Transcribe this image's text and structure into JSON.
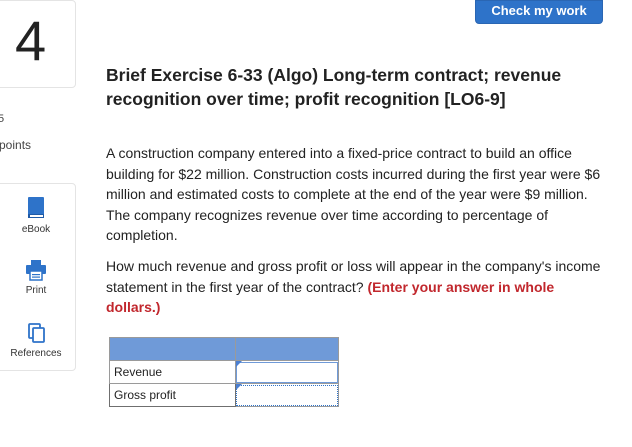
{
  "question": {
    "number": "4",
    "points_value": "5",
    "points_label": "points"
  },
  "tools": [
    {
      "label": "eBook",
      "icon": "book-icon"
    },
    {
      "label": "Print",
      "icon": "printer-icon"
    },
    {
      "label": "References",
      "icon": "references-icon"
    }
  ],
  "header": {
    "check_button": "Check my work"
  },
  "exercise": {
    "title": "Brief Exercise 6-33 (Algo) Long-term contract; revenue recognition over time; profit recognition [LO6-9]",
    "paragraph1": "A construction company entered into a fixed-price contract to build an office building for $22 million. Construction costs incurred during the first year were $6 million and estimated costs to complete at the end of the year were $9 million. The company recognizes revenue over time according to percentage of completion.",
    "paragraph2": "How much revenue and gross profit or loss will appear in the company's income statement in the first year of the contract?",
    "instruction": "(Enter your answer in whole dollars.)"
  },
  "answer_table": {
    "rows": [
      {
        "label": "Revenue",
        "value": ""
      },
      {
        "label": "Gross profit",
        "value": ""
      }
    ]
  },
  "colors": {
    "primary": "#2e73c9",
    "table_header": "#6f9ad8",
    "instruction": "#c1272d"
  }
}
